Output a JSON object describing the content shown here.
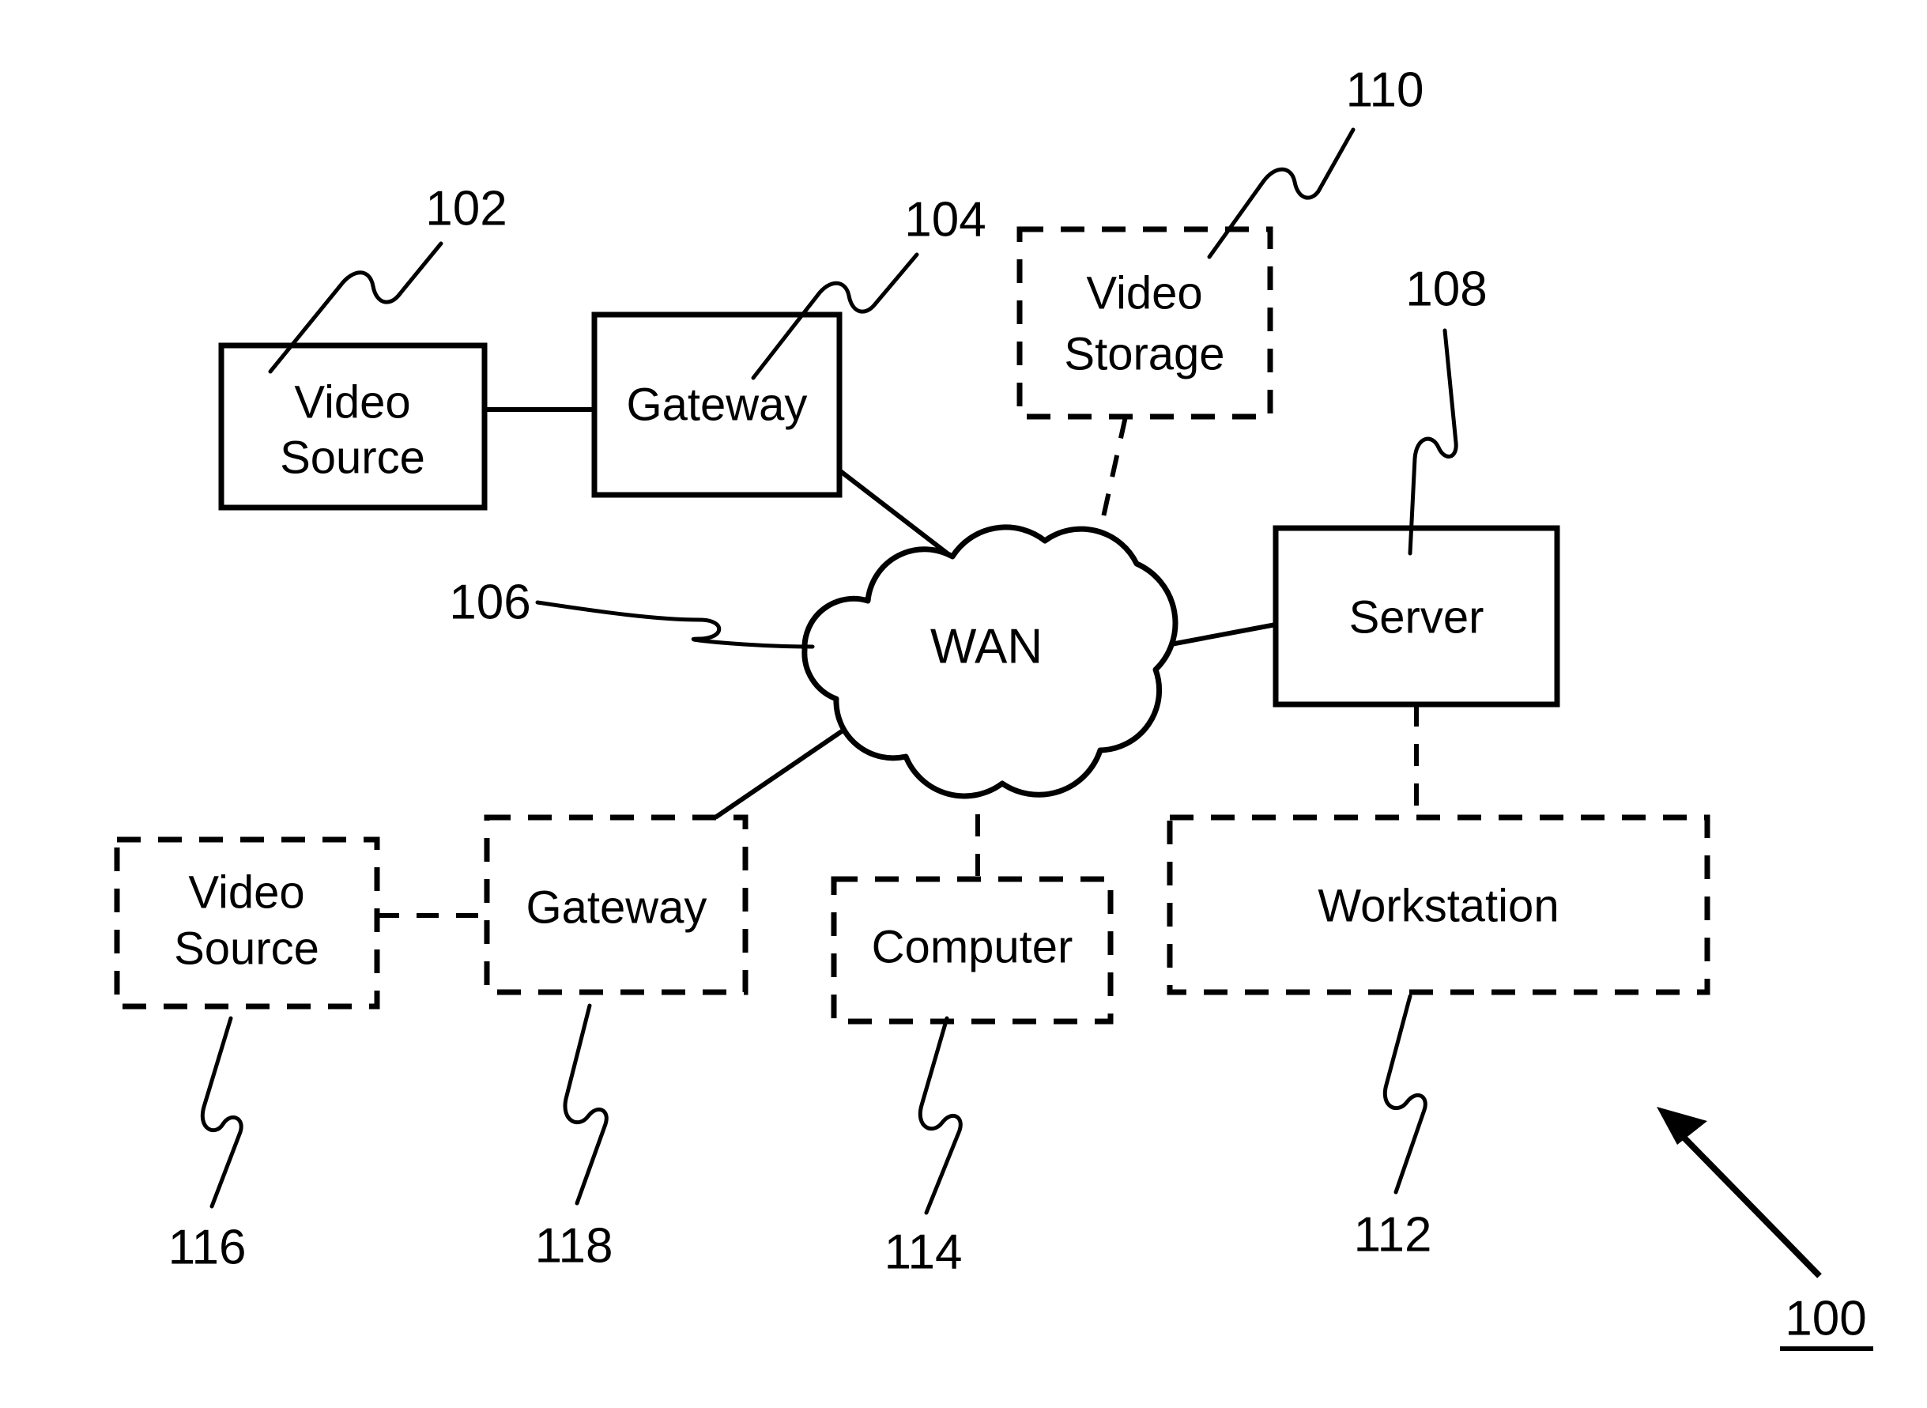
{
  "figure": {
    "figure_number": "100",
    "background_color": "#ffffff",
    "line_color": "#000000"
  },
  "nodes": {
    "video_source_top": {
      "label_line1": "Video",
      "label_line2": "Source",
      "ref": "102",
      "border": "solid"
    },
    "gateway_top": {
      "label": "Gateway",
      "ref": "104",
      "border": "solid"
    },
    "video_storage": {
      "label_line1": "Video",
      "label_line2": "Storage",
      "ref": "110",
      "border": "dashed"
    },
    "wan": {
      "label": "WAN",
      "ref": "106",
      "border": "cloud"
    },
    "server": {
      "label": "Server",
      "ref": "108",
      "border": "solid"
    },
    "video_source_bottom": {
      "label_line1": "Video",
      "label_line2": "Source",
      "ref": "116",
      "border": "dashed"
    },
    "gateway_bottom": {
      "label": "Gateway",
      "ref": "118",
      "border": "dashed"
    },
    "computer": {
      "label": "Computer",
      "ref": "114",
      "border": "dashed"
    },
    "workstation": {
      "label": "Workstation",
      "ref": "112",
      "border": "dashed"
    }
  },
  "connections": [
    {
      "from": "video_source_top",
      "to": "gateway_top",
      "style": "solid"
    },
    {
      "from": "gateway_top",
      "to": "wan",
      "style": "solid"
    },
    {
      "from": "video_storage",
      "to": "wan",
      "style": "dashed"
    },
    {
      "from": "wan",
      "to": "server",
      "style": "solid"
    },
    {
      "from": "server",
      "to": "workstation",
      "style": "dashed"
    },
    {
      "from": "wan",
      "to": "computer",
      "style": "dashed"
    },
    {
      "from": "wan",
      "to": "gateway_bottom",
      "style": "solid"
    },
    {
      "from": "video_source_bottom",
      "to": "gateway_bottom",
      "style": "dashed"
    }
  ]
}
